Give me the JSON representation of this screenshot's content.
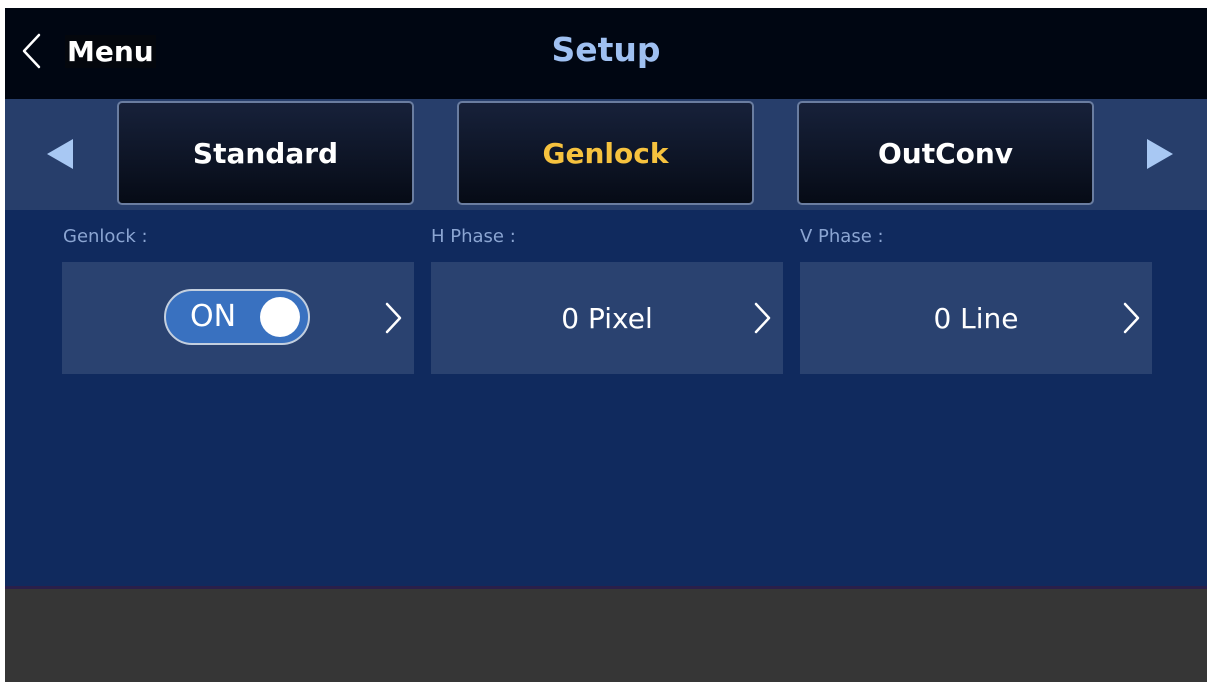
{
  "header": {
    "back_label": "Menu",
    "title": "Setup"
  },
  "tabs": [
    {
      "label": "Standard",
      "active": false
    },
    {
      "label": "Genlock",
      "active": true
    },
    {
      "label": "OutConv",
      "active": false
    }
  ],
  "fields": {
    "genlock": {
      "label": "Genlock :",
      "toggle_text": "ON",
      "state": "on"
    },
    "h_phase": {
      "label": "H Phase :",
      "value": "0 Pixel"
    },
    "v_phase": {
      "label": "V Phase :",
      "value": "0 Line"
    }
  },
  "icons": {
    "back": "chevron-left-icon",
    "prev": "triangle-left-icon",
    "next": "triangle-right-icon",
    "open": "chevron-right-icon"
  },
  "colors": {
    "accent_active_tab": "#f6c23e",
    "title": "#9fc0f1",
    "toggle_on": "#3971c0",
    "background": "#102a5e"
  }
}
